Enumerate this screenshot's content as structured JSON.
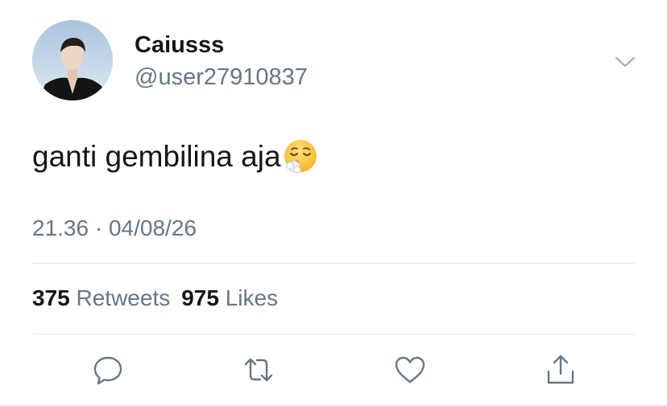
{
  "user": {
    "display_name": "Caiusss",
    "handle": "@user27910837"
  },
  "tweet": {
    "text": "ganti gembilina aja",
    "emoji": "face-exhaling-emoji",
    "time": "21.36",
    "separator": "·",
    "date": "04/08/26"
  },
  "stats": {
    "retweets_count": "375",
    "retweets_label": "Retweets",
    "likes_count": "975",
    "likes_label": "Likes"
  },
  "icons": {
    "more": "chevron-down-icon",
    "reply": "reply-icon",
    "retweet": "retweet-icon",
    "like": "heart-icon",
    "share": "share-icon"
  },
  "colors": {
    "text": "#14171a",
    "secondary": "#657786",
    "divider": "#e1e8ed"
  }
}
